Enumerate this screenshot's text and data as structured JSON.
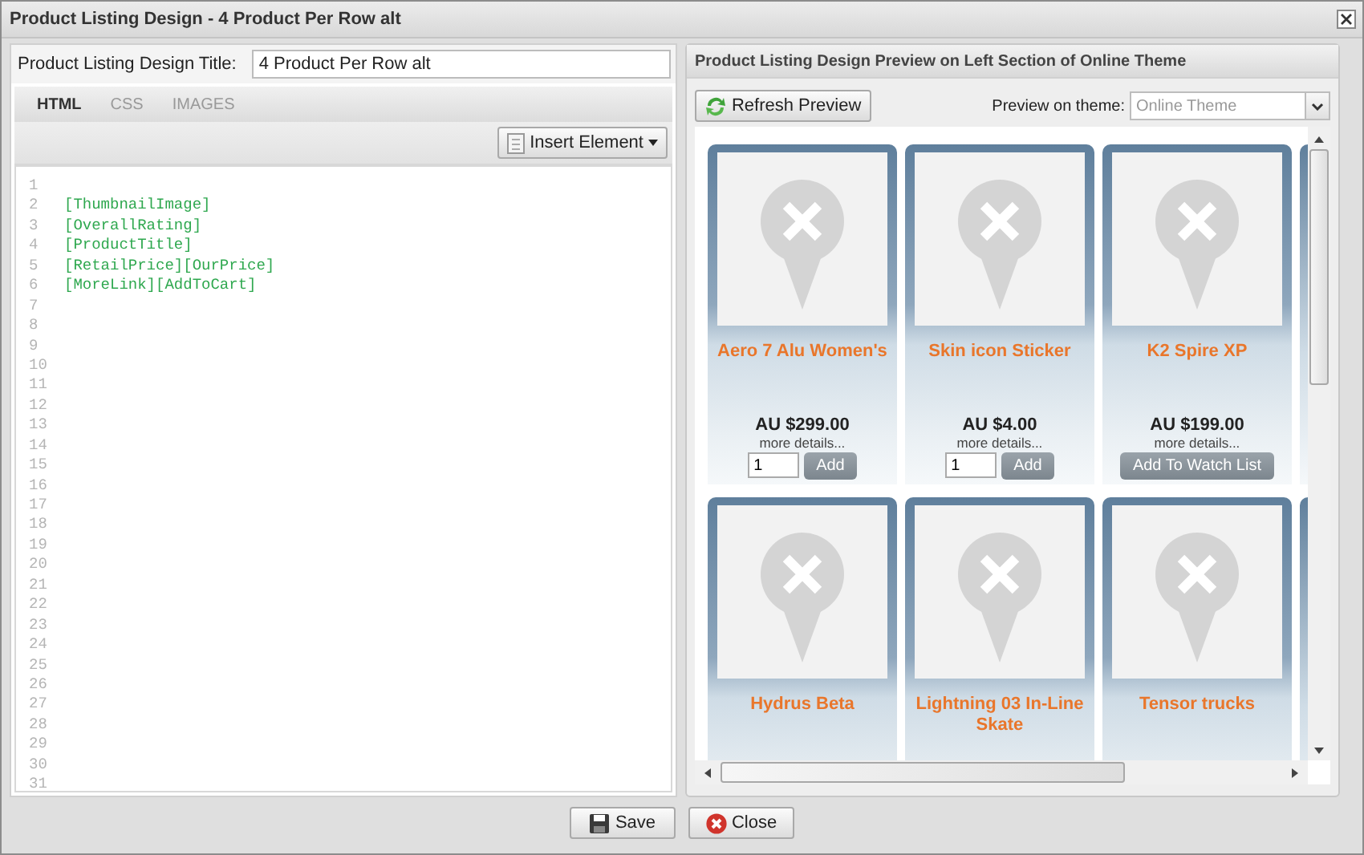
{
  "window": {
    "title": "Product Listing Design - 4 Product Per Row alt"
  },
  "title_field": {
    "label": "Product Listing Design Title:",
    "value": "4 Product Per Row alt"
  },
  "editor_tabs": [
    {
      "label": "HTML",
      "selected": true
    },
    {
      "label": "CSS",
      "selected": false
    },
    {
      "label": "IMAGES",
      "selected": false
    }
  ],
  "insert_button": {
    "label": "Insert Element"
  },
  "code_lines": [
    {
      "number": "1"
    },
    {
      "number": "2",
      "text": "[ThumbnailImage]"
    },
    {
      "number": "3",
      "text": "[OverallRating]"
    },
    {
      "number": "4",
      "text": "[ProductTitle]"
    },
    {
      "number": "5",
      "text": "[RetailPrice][OurPrice]"
    },
    {
      "number": "6",
      "text": "[MoreLink][AddToCart]"
    },
    {
      "number": "7"
    },
    {
      "number": "8"
    },
    {
      "number": "9"
    },
    {
      "number": "10"
    },
    {
      "number": "11"
    },
    {
      "number": "12"
    },
    {
      "number": "13"
    },
    {
      "number": "14"
    },
    {
      "number": "15"
    },
    {
      "number": "16"
    },
    {
      "number": "17"
    },
    {
      "number": "18"
    },
    {
      "number": "19"
    },
    {
      "number": "20"
    },
    {
      "number": "21"
    },
    {
      "number": "22"
    },
    {
      "number": "23"
    },
    {
      "number": "24"
    },
    {
      "number": "25"
    },
    {
      "number": "26"
    },
    {
      "number": "27"
    },
    {
      "number": "28"
    },
    {
      "number": "29"
    },
    {
      "number": "30"
    },
    {
      "number": "31"
    }
  ],
  "preview": {
    "title": "Product Listing Design Preview on Left Section of Online Theme",
    "refresh_button": "Refresh Preview",
    "theme_label": "Preview on theme:",
    "theme_select": {
      "placeholder": "Online Theme"
    },
    "products": [
      {
        "title": "Aero 7 Alu Women's",
        "price": "AU $299.00",
        "more": "more details...",
        "action": {
          "kind": "cart",
          "qty": "1",
          "label": "Add"
        }
      },
      {
        "title": "Skin icon Sticker",
        "price": "AU $4.00",
        "more": "more details...",
        "action": {
          "kind": "cart",
          "qty": "1",
          "label": "Add"
        }
      },
      {
        "title": "K2 Spire XP",
        "price": "AU $199.00",
        "more": "more details...",
        "action": {
          "kind": "watch",
          "label": "Add To Watch List"
        }
      },
      {
        "title": "Hydrus Beta"
      },
      {
        "title": "Lightning 03 In-Line Skate"
      },
      {
        "title": "Tensor trucks"
      }
    ]
  },
  "buttons": [
    {
      "kind": "save",
      "label": "Save"
    },
    {
      "kind": "close",
      "label": "Close"
    }
  ]
}
